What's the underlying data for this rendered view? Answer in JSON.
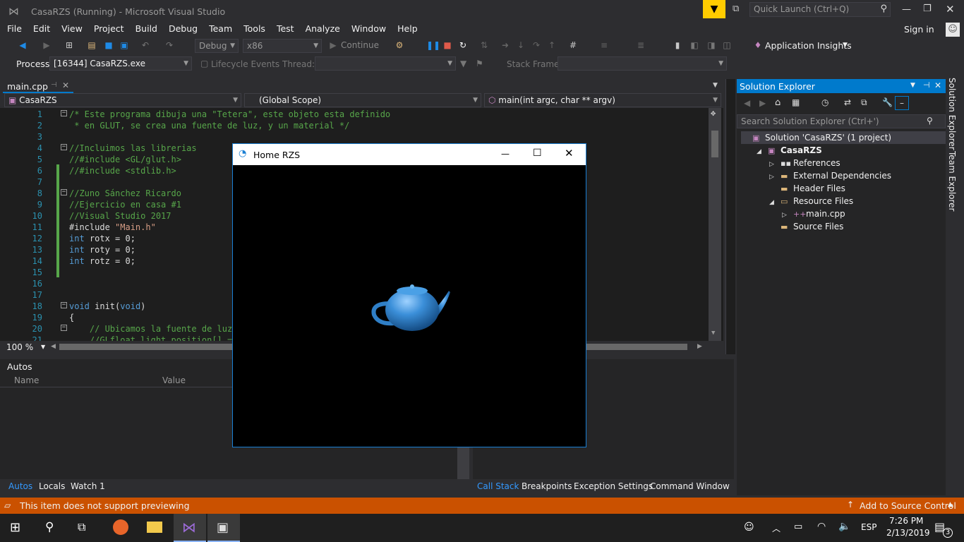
{
  "window": {
    "title": "CasaRZS (Running) - Microsoft Visual Studio",
    "quick_launch_placeholder": "Quick Launch (Ctrl+Q)",
    "sign_in": "Sign in"
  },
  "menu": [
    "File",
    "Edit",
    "View",
    "Project",
    "Build",
    "Debug",
    "Team",
    "Tools",
    "Test",
    "Analyze",
    "Window",
    "Help"
  ],
  "toolbar": {
    "config": "Debug",
    "platform": "x86",
    "continue": "Continue",
    "app_insights": "Application Insights"
  },
  "debug_bar": {
    "process_label": "Process:",
    "process_value": "[16344] CasaRZS.exe",
    "lifecycle": "Lifecycle Events",
    "thread_label": "Thread:",
    "stack_frame_label": "Stack Frame:"
  },
  "editor": {
    "tab": "main.cpp",
    "nav_project": "CasaRZS",
    "nav_scope": "(Global Scope)",
    "nav_function": "main(int argc, char ** argv)",
    "zoom": "100 %",
    "lines": [
      {
        "n": "1",
        "text": "/* Este programa dibuja una \"Tetera\", este objeto esta definido",
        "cls": "cm"
      },
      {
        "n": "2",
        "text": " * en GLUT, se crea una fuente de luz, y un material */",
        "cls": "cm"
      },
      {
        "n": "3",
        "text": "",
        "cls": "txt"
      },
      {
        "n": "4",
        "text": "//Incluimos las librerias",
        "cls": "cm"
      },
      {
        "n": "5",
        "text": "//#include <GL/glut.h>",
        "cls": "cm"
      },
      {
        "n": "6",
        "text": "//#include <stdlib.h>",
        "cls": "cm"
      },
      {
        "n": "7",
        "text": "",
        "cls": "txt"
      },
      {
        "n": "8",
        "text": "//Zuno Sánchez Ricardo",
        "cls": "cm"
      },
      {
        "n": "9",
        "text": "//Ejercicio en casa #1",
        "cls": "cm"
      },
      {
        "n": "10",
        "text": "//Visual Studio 2017",
        "cls": "cm"
      },
      {
        "n": "11",
        "text": "#include \"Main.h\"",
        "cls": "inc"
      },
      {
        "n": "12",
        "text": "int rotx = 0;",
        "cls": "int"
      },
      {
        "n": "13",
        "text": "int roty = 0;",
        "cls": "int"
      },
      {
        "n": "14",
        "text": "int rotz = 0;",
        "cls": "int"
      },
      {
        "n": "15",
        "text": "",
        "cls": "txt"
      },
      {
        "n": "16",
        "text": "",
        "cls": "txt"
      },
      {
        "n": "17",
        "text": "",
        "cls": "txt"
      },
      {
        "n": "18",
        "text": "void init(void)",
        "cls": "void"
      },
      {
        "n": "19",
        "text": "{",
        "cls": "txt"
      },
      {
        "n": "20",
        "text": "    // Ubicamos la fuente de luz",
        "cls": "cm"
      },
      {
        "n": "21",
        "text": "    //GLfloat light_position[] =",
        "cls": "cm"
      }
    ]
  },
  "autos": {
    "title": "Autos",
    "col_name": "Name",
    "col_value": "Value",
    "tabs": [
      "Autos",
      "Locals",
      "Watch 1"
    ]
  },
  "callstack": {
    "tabs": [
      "Call Stack",
      "Breakpoints",
      "Exception Settings",
      "Command Window"
    ]
  },
  "solution_explorer": {
    "title": "Solution Explorer",
    "search_placeholder": "Search Solution Explorer (Ctrl+')",
    "items": [
      {
        "label": "Solution 'CasaRZS' (1 project)",
        "indent": 0,
        "icon": "solution-icon",
        "expand": ""
      },
      {
        "label": "CasaRZS",
        "indent": 1,
        "icon": "project-icon",
        "expand": "◢",
        "bold": true
      },
      {
        "label": "References",
        "indent": 2,
        "icon": "references-icon",
        "expand": "▷"
      },
      {
        "label": "External Dependencies",
        "indent": 2,
        "icon": "folder-icon",
        "expand": "▷"
      },
      {
        "label": "Header Files",
        "indent": 2,
        "icon": "folder-icon",
        "expand": ""
      },
      {
        "label": "Resource Files",
        "indent": 2,
        "icon": "folder-open-icon",
        "expand": "◢"
      },
      {
        "label": "main.cpp",
        "indent": 3,
        "icon": "cpp-file-icon",
        "expand": "▷"
      },
      {
        "label": "Source Files",
        "indent": 2,
        "icon": "folder-icon",
        "expand": ""
      }
    ],
    "side_tabs": [
      "Solution Explorer",
      "Team Explorer"
    ]
  },
  "glut_window": {
    "title": "Home RZS",
    "teapot_color": "#3b8fd9"
  },
  "status": {
    "message": "This item does not support previewing",
    "source_control": "Add to Source Control"
  },
  "taskbar": {
    "lang": "ESP",
    "time": "7:26 PM",
    "date": "2/13/2019",
    "notif_count": "3"
  },
  "colors": {
    "accent": "#007acc",
    "status": "#ca5100",
    "bg": "#2d2d30"
  }
}
